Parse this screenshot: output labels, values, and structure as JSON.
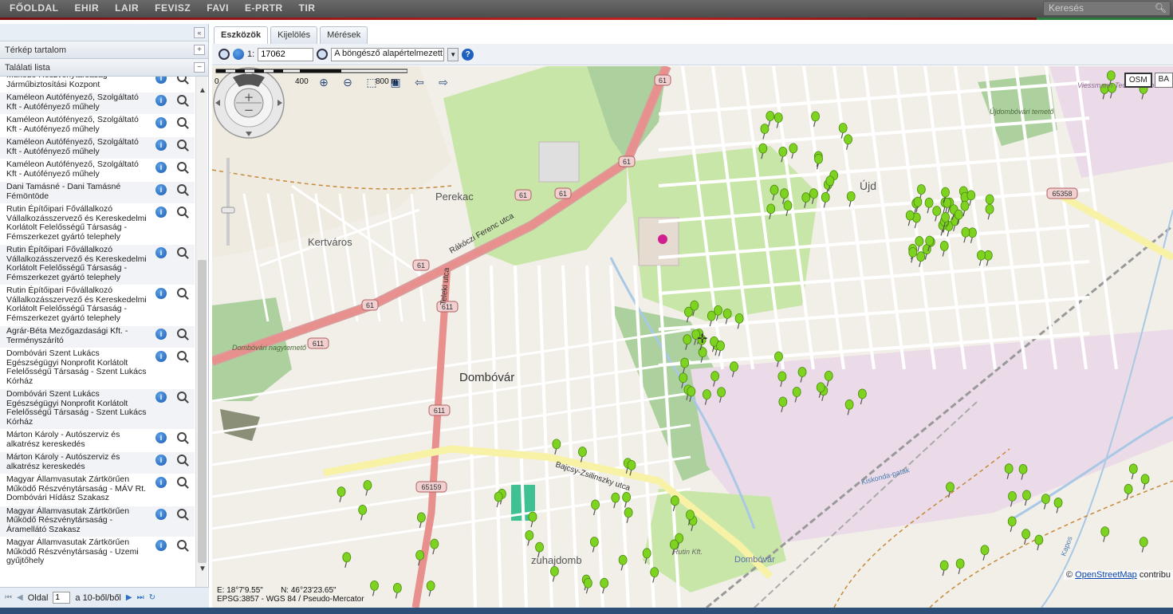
{
  "nav": {
    "items": [
      "FŐOLDAL",
      "EHIR",
      "LAIR",
      "FEVISZ",
      "FAVI",
      "E-PRTR",
      "TIR"
    ],
    "search_placeholder": "Keresés"
  },
  "left_panel": {
    "collapse_label": "«",
    "sections": {
      "map_content": "Térkép tartalom",
      "results": "Találati lista"
    },
    "rows": [
      "Működő Részvénytársaság - Járműbiztosítási Kozpont",
      "Kaméleon Autófényező, Szolgáltató Kft - Autófényező műhely",
      "Kaméleon Autófényező, Szolgáltató Kft - Autófényező műhely",
      "Kaméleon Autófényező, Szolgáltató Kft - Autófényező műhely",
      "Kaméleon Autófényező, Szolgáltató Kft - Autófényező műhely",
      "Dani Tamásné - Dani Tamásné Fémöntöde",
      "Rutin Építőipari Fővállalkozó Vállalkozásszervező és Kereskedelmi Korlátolt Felelősségű Társaság - Fémszerkezet gyártó telephely",
      "Rutin Építőipari Fővállalkozó Vállalkozásszervező és Kereskedelmi Korlátolt Felelősségű Társaság - Fémszerkezet gyártó telephely",
      "Rutin Építőipari Fővállalkozó Vállalkozásszervező és Kereskedelmi Korlátolt Felelősségű Társaság - Fémszerkezet gyártó telephely",
      "Agrár-Béta Mezőgazdasági Kft. - Terményszárító",
      "Dombóvári Szent Lukács Egészségügyi Nonprofit Korlátolt Felelősségű Társaság - Szent Lukács Kórház",
      "Dombóvári Szent Lukács Egészségügyi Nonprofit Korlátolt Felelősségű Társaság - Szent Lukács Kórház",
      "Márton Károly - Autószerviz és alkatrész kereskedés",
      "Márton Károly - Autószerviz és alkatrész kereskedés",
      "Magyar Államvasutak Zártkörűen Működő Részvénytársaság - MÁV Rt. Dombóvári Hídász Szakasz",
      "Magyar Államvasutak Zártkörűen Működő Részvénytársaság - Áramellátó Szakasz",
      "Magyar Államvasutak Zártkörűen Működő Részvénytársaság - Uzemi gyűjtőhely"
    ],
    "pager": {
      "page_label": "Oldal",
      "page_value": "1",
      "of_label": "a 10-ből/ből"
    }
  },
  "tabs": [
    "Eszközök",
    "Kijelölés",
    "Mérések"
  ],
  "toolbar": {
    "scale_prefix": "1:",
    "scale_value": "17062",
    "projection": "A böngésző alapértelmezett n"
  },
  "map": {
    "layers": [
      "OSM",
      "BA"
    ],
    "coords_e": "E: 18°7'9.55\"",
    "coords_n": "N: 46°23'23.65\"",
    "crs": "EPSG:3857 - WGS 84 / Pseudo-Mercator",
    "attribution_prefix": "©",
    "attribution_link": "OpenStreetMap",
    "attribution_suffix": "contribu",
    "scale_ticks": [
      "0",
      "400",
      "800 m"
    ],
    "labels": {
      "perekac": "Perekac",
      "kertvaros": "Kertváros",
      "dombovar": "Dombóvár",
      "ujdombovar": "Újd",
      "szuhajdomb": "zuhajdomb",
      "dombovar_station": "Dombóvár",
      "rutin": "Rutin Kft.",
      "viessmann": "Viessmann Technika Dombóvár Kft.",
      "cemetery1": "Dombóvári nagytemető",
      "cemetery2": "Újdombóvári temető",
      "rakoczi": "Rákóczi Ferenc utca",
      "teleki": "Teleki utca",
      "bajcsy": "Bajcsy-Zsilinszky utca",
      "kiskondai": "Kiskonda-patak",
      "kapos": "Kapos"
    },
    "road_shields": [
      "61",
      "61",
      "61",
      "61",
      "61",
      "61",
      "611",
      "611",
      "611",
      "65159",
      "65358"
    ],
    "colors": {
      "primary_road": "#e8908e",
      "minor_road": "#ffffff",
      "yellow_road": "#f7f2a6",
      "park": "#c8e6a8",
      "forest": "#add19e",
      "residential": "#e0dfdf",
      "industrial": "#ebdbe8",
      "marker": "#7ed321"
    }
  }
}
